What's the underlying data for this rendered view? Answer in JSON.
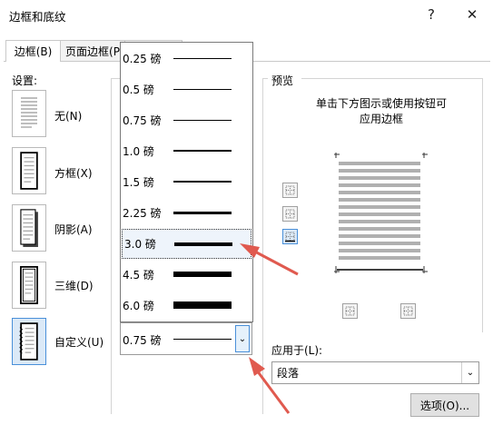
{
  "window": {
    "title": "边框和底纹",
    "help_label": "?",
    "close_label": "✕"
  },
  "tabs": [
    {
      "label": "边框(B)"
    },
    {
      "label": "页面边框(P"
    },
    {
      "label": ""
    }
  ],
  "settings": {
    "label": "设置:",
    "items": [
      {
        "label": "无(N)"
      },
      {
        "label": "方框(X)"
      },
      {
        "label": "阴影(A)"
      },
      {
        "label": "三维(D)"
      },
      {
        "label": "自定义(U)"
      }
    ]
  },
  "width_dropdown": {
    "options": [
      "0.25 磅",
      "0.5 磅",
      "0.75 磅",
      "1.0 磅",
      "1.5 磅",
      "2.25 磅",
      "3.0 磅",
      "4.5 磅",
      "6.0 磅"
    ],
    "highlighted": "3.0 磅",
    "selected_value": "0.75 磅",
    "arrow": "⌄"
  },
  "preview": {
    "label": "预览",
    "help_line1": "单击下方图示或使用按钮可",
    "help_line2": "应用边框"
  },
  "apply_to": {
    "label": "应用于(L):",
    "value": "段落",
    "arrow": "⌄"
  },
  "options_button": {
    "label": "选项(O)..."
  },
  "colors": {
    "accent": "#4a90d9",
    "arrow": "#e05a4f"
  }
}
